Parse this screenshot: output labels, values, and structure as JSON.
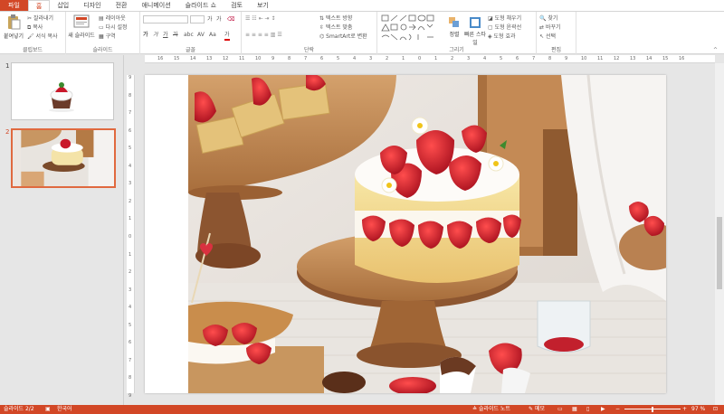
{
  "tabs": [
    "파일",
    "홈",
    "삽입",
    "디자인",
    "전환",
    "애니메이션",
    "슬라이드 쇼",
    "검토",
    "보기"
  ],
  "ribbon": {
    "clipboard": {
      "paste": "붙여넣기",
      "cut": "잘라내기",
      "copy": "복사",
      "format_painter": "서식 복사",
      "label": "클립보드"
    },
    "slides": {
      "new_slide": "새 슬라이드",
      "layout": "레이아웃",
      "reset": "다시 설정",
      "section": "구역",
      "label": "슬라이드"
    },
    "font": {
      "label": "글꼴",
      "size_up": "가",
      "size_down": "가",
      "bold": "가",
      "italic": "가",
      "underline": "가",
      "strike": "가",
      "shadow": "abc",
      "spacing": "AV",
      "case": "Aa",
      "color": "가"
    },
    "paragraph": {
      "label": "단락",
      "text_direction": "텍스트 방향",
      "align_text": "텍스트 맞춤",
      "smartart": "SmartArt로 변환"
    },
    "drawing": {
      "label": "그리기",
      "arrange": "정렬",
      "quick_styles": "빠른 스타일",
      "fill": "도형 채우기",
      "outline": "도형 윤곽선",
      "effects": "도형 효과"
    },
    "editing": {
      "label": "편집",
      "find": "찾기",
      "replace": "바꾸기",
      "select": "선택"
    }
  },
  "thumbnails": [
    {
      "number": "1"
    },
    {
      "number": "2"
    }
  ],
  "ruler": {
    "h": [
      "16",
      "15",
      "14",
      "13",
      "12",
      "11",
      "10",
      "9",
      "8",
      "7",
      "6",
      "5",
      "4",
      "3",
      "2",
      "1",
      "0",
      "1",
      "2",
      "3",
      "4",
      "5",
      "6",
      "7",
      "8",
      "9",
      "10",
      "11",
      "12",
      "13",
      "14",
      "15",
      "16"
    ],
    "v": [
      "9",
      "8",
      "7",
      "6",
      "5",
      "4",
      "3",
      "2",
      "1",
      "0",
      "1",
      "2",
      "3",
      "4",
      "5",
      "6",
      "7",
      "8",
      "9"
    ]
  },
  "status": {
    "slide_info": "슬라이드 2/2",
    "language": "한국어",
    "notes": "슬라이드 노트",
    "comments": "메모",
    "zoom": "97 %"
  },
  "colors": {
    "accent": "#d24726",
    "selected_thumb": "#e0693f"
  }
}
